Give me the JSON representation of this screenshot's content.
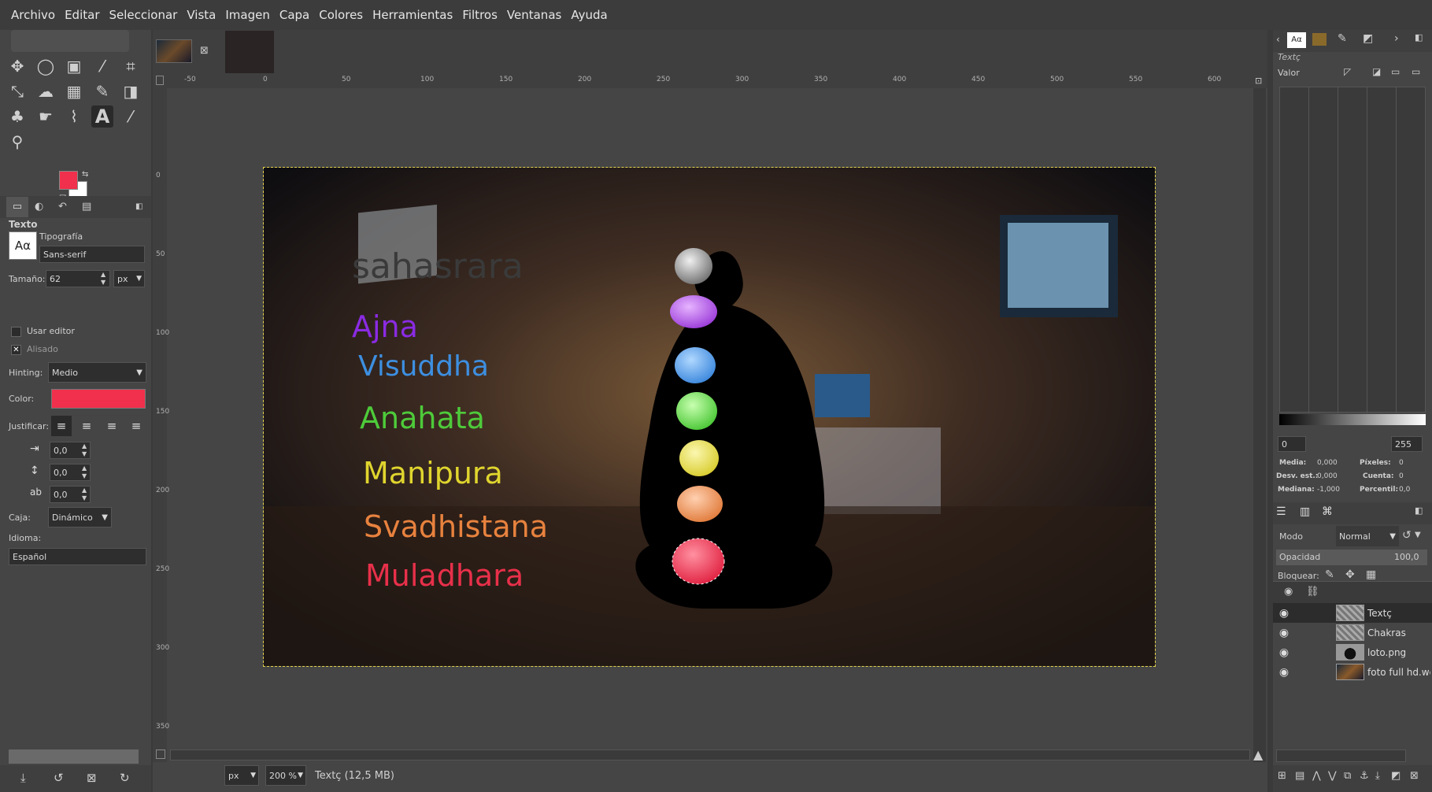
{
  "menu": [
    "Archivo",
    "Editar",
    "Seleccionar",
    "Vista",
    "Imagen",
    "Capa",
    "Colores",
    "Herramientas",
    "Filtros",
    "Ventanas",
    "Ayuda"
  ],
  "tool_options": {
    "section_title": "Texto",
    "font_label": "Tipografía",
    "font_value": "Sans-serif",
    "size_label": "Tamaño:",
    "size_value": "62",
    "size_unit": "px",
    "use_editor_label": "Usar editor",
    "antialias_label": "Alisado",
    "hinting_label": "Hinting:",
    "hinting_value": "Medio",
    "color_label": "Color:",
    "color_value": "#f0304c",
    "justify_label": "Justificar:",
    "indent_value": "0,0",
    "line_spacing_value": "0,0",
    "letter_spacing_value": "0,0",
    "box_label": "Caja:",
    "box_value": "Dinámico",
    "language_label": "Idioma:",
    "language_value": "Español",
    "font_preview": "Aα"
  },
  "rulers": {
    "top": [
      "-50",
      "0",
      "50",
      "100",
      "150",
      "200",
      "250",
      "300",
      "350",
      "400",
      "450",
      "500",
      "550",
      "600"
    ],
    "left": [
      "0",
      "50",
      "100",
      "150",
      "200",
      "250",
      "300",
      "350"
    ]
  },
  "canvas": {
    "labels": [
      {
        "text": "sahasrara",
        "color": "#3a3a3a"
      },
      {
        "text": "Ajna",
        "color": "#8a2be2"
      },
      {
        "text": "Visuddha",
        "color": "#3d8fe0"
      },
      {
        "text": "Anahata",
        "color": "#4ecb3a"
      },
      {
        "text": "Manipura",
        "color": "#e0d52e"
      },
      {
        "text": "Svadhistana",
        "color": "#e8823e"
      },
      {
        "text": "Muladhara",
        "color": "#e8304a"
      }
    ]
  },
  "statusbar": {
    "unit": "px",
    "zoom": "200 %",
    "info": "Textç (12,5 MB)"
  },
  "histogram": {
    "panel_title": "Textç",
    "channel": "Valor",
    "range_min": "0",
    "range_max": "255",
    "stats": [
      {
        "label": "Media:",
        "value": "0,000"
      },
      {
        "label": "Desv. est.:",
        "value": "0,000"
      },
      {
        "label": "Mediana:",
        "value": "-1,000"
      },
      {
        "label": "Píxeles:",
        "value": "0"
      },
      {
        "label": "Cuenta:",
        "value": "0"
      },
      {
        "label": "Percentil:",
        "value": "0,0"
      }
    ]
  },
  "layers": {
    "mode_label": "Modo",
    "mode_value": "Normal",
    "opacity_label": "Opacidad",
    "opacity_value": "100,0",
    "lock_label": "Bloquear:",
    "items": [
      {
        "name": "Textç"
      },
      {
        "name": "Chakras"
      },
      {
        "name": "loto.png"
      },
      {
        "name": "foto full hd.webp"
      }
    ]
  },
  "colors": {
    "fg": "#f0304c",
    "bg": "#ffffff"
  }
}
